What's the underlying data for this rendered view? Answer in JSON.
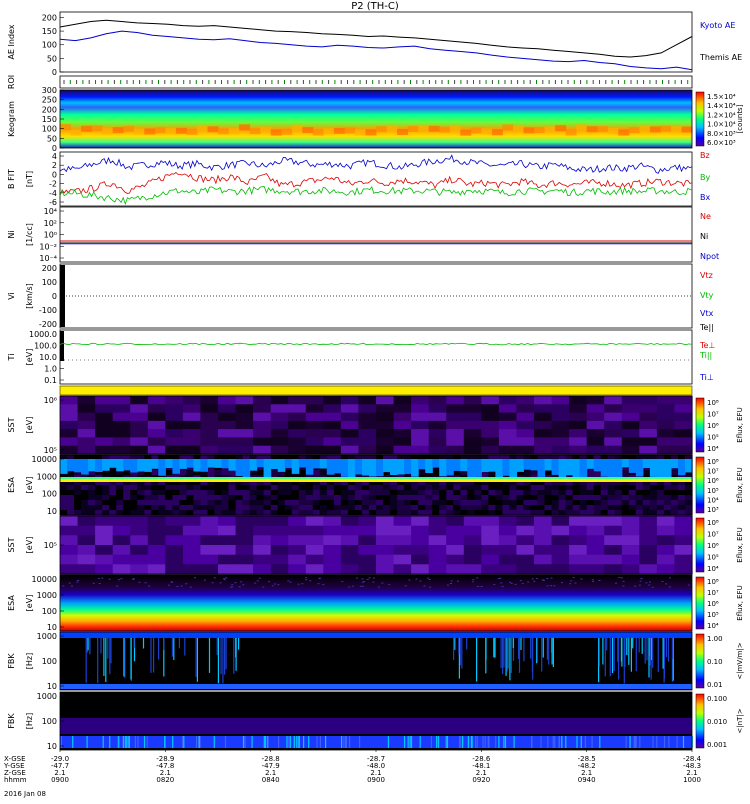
{
  "title": "P2 (TH-C)",
  "date_label": "2016 Jan 08",
  "time_axis": {
    "rows": [
      {
        "label": "X-GSE",
        "values": [
          "-29.0",
          "-28.9",
          "-28.8",
          "-28.7",
          "-28.6",
          "-28.5",
          "-28.4"
        ]
      },
      {
        "label": "Y-GSE",
        "values": [
          "-47.7",
          "-47.8",
          "-47.9",
          "-48.0",
          "-48.1",
          "-48.2",
          "-48.3"
        ]
      },
      {
        "label": "Z-GSE",
        "values": [
          "2.1",
          "2.1",
          "2.1",
          "2.1",
          "2.1",
          "2.1",
          "2.1"
        ]
      },
      {
        "label": "hhmm",
        "values": [
          "0900",
          "0820",
          "0840",
          "0900",
          "0920",
          "0940",
          "1000"
        ]
      }
    ]
  },
  "colors": {
    "black": "#000000",
    "blue": "#0000cc",
    "red": "#dd0000",
    "green": "#00bb00"
  },
  "chart_data": [
    {
      "type": "line",
      "id": "ae",
      "ylabel": "AE Index",
      "yticks": [
        "0",
        "50",
        "100",
        "150",
        "200"
      ],
      "ylim": [
        0,
        220
      ],
      "legend": [
        "Kyoto AE",
        "Themis AE"
      ],
      "series": [
        {
          "name": "Kyoto AE",
          "color": "#0000cc",
          "values": [
            120,
            115,
            125,
            140,
            150,
            145,
            135,
            130,
            125,
            120,
            118,
            122,
            115,
            108,
            105,
            100,
            95,
            92,
            98,
            95,
            90,
            88,
            92,
            95,
            85,
            80,
            75,
            70,
            62,
            55,
            50,
            45,
            40,
            38,
            42,
            35,
            30,
            20,
            15,
            12,
            18,
            8
          ]
        },
        {
          "name": "Themis AE",
          "color": "#000000",
          "values": [
            165,
            175,
            185,
            190,
            185,
            180,
            178,
            175,
            170,
            168,
            170,
            165,
            160,
            155,
            150,
            148,
            145,
            140,
            138,
            135,
            130,
            132,
            128,
            125,
            120,
            115,
            110,
            105,
            98,
            92,
            88,
            85,
            80,
            75,
            70,
            65,
            58,
            55,
            60,
            70,
            100,
            130
          ]
        }
      ]
    },
    {
      "type": "ticks",
      "id": "roi",
      "ylabel": "ROI"
    },
    {
      "type": "heatmap",
      "id": "keogram",
      "ylabel": "Keogram",
      "yticks": [
        "0",
        "50",
        "100",
        "150",
        "200",
        "250",
        "300"
      ],
      "colorbar_ticks": [
        "1.5×10⁴",
        "1.4×10⁴",
        "1.2×10⁴",
        "1.0×10⁴",
        "8.0×10³",
        "6.0×10³"
      ],
      "colorbar_label": "[counts]"
    },
    {
      "type": "line",
      "id": "bfield",
      "ylabel": "B FIT",
      "yunit": "[nT]",
      "yticks": [
        "4",
        "2",
        "0",
        "-2",
        "-4",
        "-6"
      ],
      "ylim": [
        -6,
        4.5
      ],
      "legend": [
        "Bz",
        "By",
        "Bx"
      ],
      "series": [
        {
          "name": "Bz",
          "color": "#0000cc",
          "values": [
            1.0,
            1.2,
            2.2,
            3.0,
            1.5,
            2.0,
            2.5,
            1.8,
            2.2,
            1.5,
            2.0,
            2.3,
            1.7,
            2.8,
            2.5,
            2.0,
            2.2,
            1.8,
            2.5,
            2.0,
            1.5,
            2.2,
            2.8,
            3.2,
            2.5,
            2.0,
            1.8,
            2.2,
            1.6,
            2.0,
            1.2,
            1.0,
            1.5,
            1.3,
            1.8,
            1.0,
            1.5,
            1.2
          ]
        },
        {
          "name": "By",
          "color": "#dd0000",
          "values": [
            -3.5,
            -3.2,
            -2.5,
            -1.5,
            -3.0,
            -2.0,
            -0.5,
            0.8,
            -0.5,
            -1.0,
            -0.3,
            -1.5,
            -0.2,
            -2.0,
            -1.5,
            -1.0,
            -0.5,
            -1.8,
            -1.0,
            -1.5,
            -1.0,
            -1.3,
            -2.0,
            -0.8,
            -1.8,
            -1.5,
            -2.0,
            -1.2,
            -2.0,
            -1.5,
            -1.8,
            -1.5,
            -1.5,
            -2.0,
            -1.6,
            -1.2,
            -1.5,
            -1.8
          ]
        },
        {
          "name": "Bx",
          "color": "#00bb00",
          "values": [
            -3.5,
            -3.6,
            -4.0,
            -4.5,
            -5.0,
            -4.2,
            -3.5,
            -3.0,
            -3.5,
            -2.8,
            -3.2,
            -3.0,
            -2.8,
            -3.0,
            -3.2,
            -3.0,
            -3.1,
            -3.3,
            -2.9,
            -3.0,
            -3.1,
            -3.0,
            -3.2,
            -3.4,
            -2.9,
            -3.1,
            -3.5,
            -3.0,
            -3.2,
            -3.0,
            -3.4,
            -3.0,
            -3.3,
            -3.0,
            -3.2,
            -3.0,
            -3.3,
            -3.1
          ]
        }
      ]
    },
    {
      "type": "line",
      "id": "density",
      "ylabel": "Ni",
      "yunit": "[1/cc]",
      "yticks": [
        "10⁴",
        "10²",
        "10⁰",
        "10⁻²",
        "10⁻⁴"
      ],
      "legend": [
        "Ne",
        "Ni",
        "Npot"
      ]
    },
    {
      "type": "line",
      "id": "velocity",
      "ylabel": "Vi",
      "yunit": "[km/s]",
      "yticks": [
        "200",
        "100",
        "0",
        "-100",
        "-200"
      ],
      "legend": [
        "Vtz",
        "Vty",
        "Vtx"
      ]
    },
    {
      "type": "line",
      "id": "temperature",
      "ylabel": "Ti",
      "yunit": "[eV]",
      "yticks": [
        "1000.0",
        "100.0",
        "10.0",
        "1.0",
        "0.1"
      ],
      "legend": [
        "Te||",
        "Te⊥",
        "Ti||",
        "Ti⊥"
      ]
    },
    {
      "type": "heatmap",
      "id": "sst_ions",
      "ylabel": "SST",
      "yunit": "[eV]",
      "yticks": [
        "10⁶",
        "10⁵"
      ],
      "colorbar_ticks": [
        "10⁸",
        "10⁷",
        "10⁶",
        "10⁵",
        "10⁴"
      ],
      "colorbar_label": "Eflux, EFU"
    },
    {
      "type": "heatmap",
      "id": "esa_ions",
      "ylabel": "ESA",
      "yunit": "[eV]",
      "yticks": [
        "10000",
        "1000",
        "100",
        "10"
      ],
      "colorbar_ticks": [
        "10⁸",
        "10⁷",
        "10⁶",
        "10⁵",
        "10⁴",
        "10³"
      ],
      "colorbar_label": "Eflux, EFU"
    },
    {
      "type": "heatmap",
      "id": "sst_elec",
      "ylabel": "SST",
      "yunit": "[eV]",
      "yticks": [
        "10⁵"
      ],
      "colorbar_ticks": [
        "10⁸",
        "10⁷",
        "10⁶",
        "10⁵",
        "10⁴"
      ],
      "colorbar_label": "Eflux, EFU"
    },
    {
      "type": "heatmap",
      "id": "esa_elec",
      "ylabel": "ESA",
      "yunit": "[eV]",
      "yticks": [
        "10000",
        "1000",
        "100",
        "10"
      ],
      "colorbar_ticks": [
        "10⁸",
        "10⁷",
        "10⁶",
        "10⁵",
        "10⁴"
      ],
      "colorbar_label": "Eflux, EFU"
    },
    {
      "type": "heatmap",
      "id": "fbk_e",
      "ylabel": "FBK",
      "yunit": "[Hz]",
      "yticks": [
        "1000",
        "100",
        "10"
      ],
      "colorbar_ticks": [
        "1.00",
        "0.10",
        "0.01"
      ],
      "colorbar_label": "<|mV/m|>"
    },
    {
      "type": "heatmap",
      "id": "fbk_b",
      "ylabel": "FBK",
      "yunit": "[Hz]",
      "yticks": [
        "1000",
        "100",
        "10"
      ],
      "colorbar_ticks": [
        "0.100",
        "0.010",
        "0.001"
      ],
      "colorbar_label": "<|nT|>"
    }
  ]
}
